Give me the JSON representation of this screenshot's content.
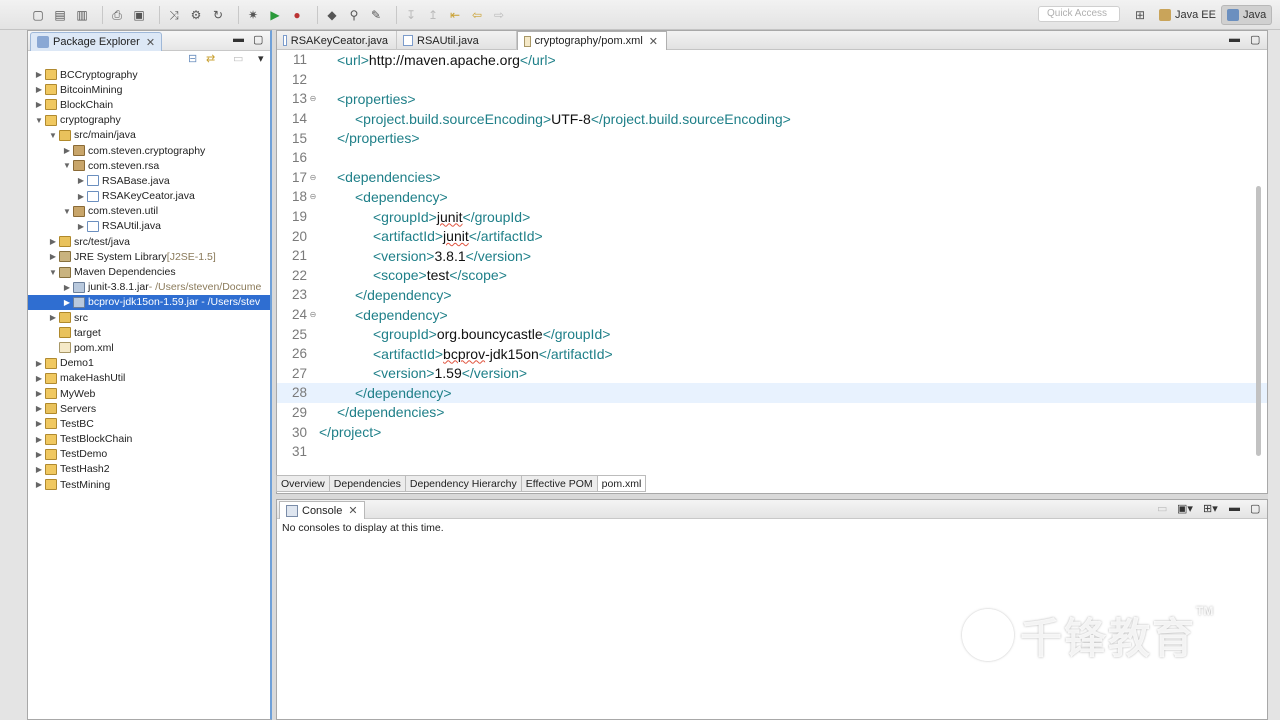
{
  "toolbar": {
    "quick_access_placeholder": "Quick Access",
    "perspectives": [
      {
        "label": "Java EE",
        "active": false
      },
      {
        "label": "Java",
        "active": true
      }
    ]
  },
  "explorer": {
    "tab_label": "Package Explorer",
    "tree": [
      {
        "depth": 0,
        "expanded": false,
        "icon": "project",
        "label": "BCCryptography",
        "decor": ""
      },
      {
        "depth": 0,
        "expanded": false,
        "icon": "project",
        "label": "BitcoinMining",
        "decor": ""
      },
      {
        "depth": 0,
        "expanded": false,
        "icon": "project",
        "label": "BlockChain",
        "decor": ""
      },
      {
        "depth": 0,
        "expanded": true,
        "icon": "project",
        "label": "cryptography",
        "decor": ""
      },
      {
        "depth": 1,
        "expanded": true,
        "icon": "folder",
        "label": "src/main/java",
        "decor": ""
      },
      {
        "depth": 2,
        "expanded": false,
        "icon": "pkg",
        "label": "com.steven.cryptography",
        "decor": ""
      },
      {
        "depth": 2,
        "expanded": true,
        "icon": "pkg",
        "label": "com.steven.rsa",
        "decor": ""
      },
      {
        "depth": 3,
        "expanded": false,
        "icon": "java",
        "label": "RSABase.java",
        "decor": ""
      },
      {
        "depth": 3,
        "expanded": false,
        "icon": "java",
        "label": "RSAKeyCeator.java",
        "decor": ""
      },
      {
        "depth": 2,
        "expanded": true,
        "icon": "pkg",
        "label": "com.steven.util",
        "decor": ""
      },
      {
        "depth": 3,
        "expanded": false,
        "icon": "java",
        "label": "RSAUtil.java",
        "decor": ""
      },
      {
        "depth": 1,
        "expanded": false,
        "icon": "folder",
        "label": "src/test/java",
        "decor": ""
      },
      {
        "depth": 1,
        "expanded": false,
        "icon": "lib",
        "label": "JRE System Library",
        "decor": " [J2SE-1.5]"
      },
      {
        "depth": 1,
        "expanded": true,
        "icon": "lib",
        "label": "Maven Dependencies",
        "decor": ""
      },
      {
        "depth": 2,
        "expanded": false,
        "icon": "jar",
        "label": "junit-3.8.1.jar",
        "decor": " - /Users/steven/Docume"
      },
      {
        "depth": 2,
        "expanded": false,
        "icon": "jar",
        "label": "bcprov-jdk15on-1.59.jar - /Users/stev",
        "decor": "",
        "selected": true
      },
      {
        "depth": 1,
        "expanded": false,
        "icon": "folder",
        "label": "src",
        "decor": ""
      },
      {
        "depth": 1,
        "expanded": null,
        "icon": "folder",
        "label": "target",
        "decor": ""
      },
      {
        "depth": 1,
        "expanded": null,
        "icon": "xml",
        "label": "pom.xml",
        "decor": ""
      },
      {
        "depth": 0,
        "expanded": false,
        "icon": "project",
        "label": "Demo1",
        "decor": ""
      },
      {
        "depth": 0,
        "expanded": false,
        "icon": "project",
        "label": "makeHashUtil",
        "decor": ""
      },
      {
        "depth": 0,
        "expanded": false,
        "icon": "project",
        "label": "MyWeb",
        "decor": ""
      },
      {
        "depth": 0,
        "expanded": false,
        "icon": "folder",
        "label": "Servers",
        "decor": ""
      },
      {
        "depth": 0,
        "expanded": false,
        "icon": "project",
        "label": "TestBC",
        "decor": ""
      },
      {
        "depth": 0,
        "expanded": false,
        "icon": "project",
        "label": "TestBlockChain",
        "decor": ""
      },
      {
        "depth": 0,
        "expanded": false,
        "icon": "project",
        "label": "TestDemo",
        "decor": ""
      },
      {
        "depth": 0,
        "expanded": false,
        "icon": "project",
        "label": "TestHash2",
        "decor": ""
      },
      {
        "depth": 0,
        "expanded": false,
        "icon": "project",
        "label": "TestMining",
        "decor": ""
      }
    ]
  },
  "editor": {
    "tabs": [
      {
        "label": "RSAKeyCeator.java",
        "active": false
      },
      {
        "label": "RSAUtil.java",
        "active": false
      },
      {
        "label": "cryptography/pom.xml",
        "active": true
      }
    ],
    "lines": [
      {
        "n": "11",
        "fold": "",
        "indent": 1,
        "parts": [
          [
            "t",
            "<url>"
          ],
          [
            "x",
            "http://maven.apache.org"
          ],
          [
            "t",
            "</url>"
          ]
        ]
      },
      {
        "n": "12",
        "fold": "",
        "indent": 0,
        "parts": []
      },
      {
        "n": "13",
        "fold": "⊖",
        "indent": 1,
        "parts": [
          [
            "t",
            "<properties>"
          ]
        ]
      },
      {
        "n": "14",
        "fold": "",
        "indent": 2,
        "parts": [
          [
            "t",
            "<project.build.sourceEncoding>"
          ],
          [
            "x",
            "UTF-8"
          ],
          [
            "t",
            "</project.build.sourceEncoding>"
          ]
        ]
      },
      {
        "n": "15",
        "fold": "",
        "indent": 1,
        "parts": [
          [
            "t",
            "</properties>"
          ]
        ]
      },
      {
        "n": "16",
        "fold": "",
        "indent": 0,
        "parts": []
      },
      {
        "n": "17",
        "fold": "⊖",
        "indent": 1,
        "parts": [
          [
            "t",
            "<dependencies>"
          ]
        ]
      },
      {
        "n": "18",
        "fold": "⊖",
        "indent": 2,
        "parts": [
          [
            "t",
            "<dependency>"
          ]
        ]
      },
      {
        "n": "19",
        "fold": "",
        "indent": 3,
        "parts": [
          [
            "t",
            "<groupId>"
          ],
          [
            "e",
            "junit"
          ],
          [
            "t",
            "</groupId>"
          ]
        ]
      },
      {
        "n": "20",
        "fold": "",
        "indent": 3,
        "parts": [
          [
            "t",
            "<artifactId>"
          ],
          [
            "e",
            "junit"
          ],
          [
            "t",
            "</artifactId>"
          ]
        ]
      },
      {
        "n": "21",
        "fold": "",
        "indent": 3,
        "parts": [
          [
            "t",
            "<version>"
          ],
          [
            "x",
            "3.8.1"
          ],
          [
            "t",
            "</version>"
          ]
        ]
      },
      {
        "n": "22",
        "fold": "",
        "indent": 3,
        "parts": [
          [
            "t",
            "<scope>"
          ],
          [
            "x",
            "test"
          ],
          [
            "t",
            "</scope>"
          ]
        ]
      },
      {
        "n": "23",
        "fold": "",
        "indent": 2,
        "parts": [
          [
            "t",
            "</dependency>"
          ]
        ]
      },
      {
        "n": "24",
        "fold": "⊖",
        "indent": 2,
        "parts": [
          [
            "t",
            "<dependency>"
          ]
        ]
      },
      {
        "n": "25",
        "fold": "",
        "indent": 3,
        "parts": [
          [
            "t",
            "<groupId>"
          ],
          [
            "x",
            "org.bouncycastle"
          ],
          [
            "t",
            "</groupId>"
          ]
        ]
      },
      {
        "n": "26",
        "fold": "",
        "indent": 3,
        "parts": [
          [
            "t",
            "<artifactId>"
          ],
          [
            "e",
            "bcprov"
          ],
          [
            "x",
            "-jdk15on"
          ],
          [
            "t",
            "</artifactId>"
          ]
        ]
      },
      {
        "n": "27",
        "fold": "",
        "indent": 3,
        "parts": [
          [
            "t",
            "<version>"
          ],
          [
            "x",
            "1.59"
          ],
          [
            "t",
            "</version>"
          ]
        ]
      },
      {
        "n": "28",
        "fold": "",
        "indent": 2,
        "parts": [
          [
            "t",
            "</dependency>"
          ]
        ],
        "highlight": true
      },
      {
        "n": "29",
        "fold": "",
        "indent": 1,
        "parts": [
          [
            "t",
            "</dependencies>"
          ]
        ]
      },
      {
        "n": "30",
        "fold": "",
        "indent": 0,
        "parts": [
          [
            "t",
            "</project>"
          ]
        ]
      },
      {
        "n": "31",
        "fold": "",
        "indent": 0,
        "parts": []
      }
    ],
    "bottom_tabs": [
      {
        "label": "Overview",
        "active": false
      },
      {
        "label": "Dependencies",
        "active": false
      },
      {
        "label": "Dependency Hierarchy",
        "active": false
      },
      {
        "label": "Effective POM",
        "active": false
      },
      {
        "label": "pom.xml",
        "active": true
      }
    ]
  },
  "console": {
    "tab_label": "Console",
    "message": "No consoles to display at this time."
  },
  "watermark": {
    "text": "千锋教育",
    "tm": "TM"
  },
  "colors": {
    "tag": "#1e7f88",
    "selection": "#2f6ed1",
    "highlight_line": "#e8f2fe"
  }
}
